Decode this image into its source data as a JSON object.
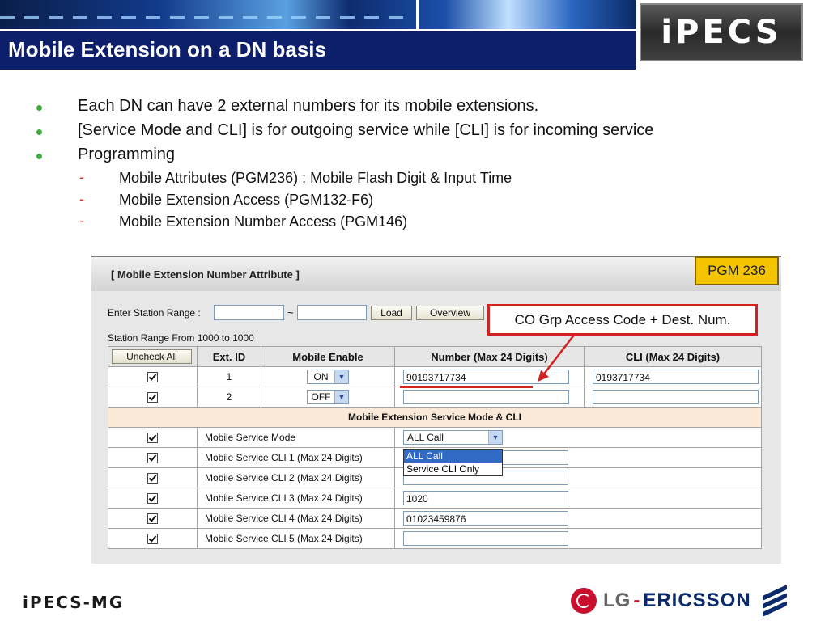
{
  "header": {
    "title": "Mobile Extension on a DN basis",
    "logo_text": "iPECS"
  },
  "bullets": [
    "Each DN can have 2 external numbers for its mobile extensions.",
    "[Service Mode and CLI] is for outgoing service while [CLI] is for incoming service",
    "Programming"
  ],
  "sub_bullets": [
    "Mobile Attributes (PGM236) : Mobile Flash Digit & Input Time",
    "Mobile Extension Access (PGM132-F6)",
    "Mobile Extension Number Access (PGM146)"
  ],
  "panel": {
    "title": "[ Mobile Extension Number Attribute ]",
    "pgm_badge": "PGM 236",
    "range_label": "Enter Station Range :",
    "range_from_value": "",
    "range_to_value": "",
    "load_label": "Load",
    "overview_label": "Overview",
    "range_info": "Station Range From 1000 to 1000",
    "callout": "CO Grp Access Code + Dest. Num.",
    "columns": {
      "uncheck_all": "Uncheck All",
      "ext_id": "Ext. ID",
      "mobile_enable": "Mobile Enable",
      "number": "Number (Max 24 Digits)",
      "cli": "CLI (Max 24 Digits)"
    },
    "ext_rows": [
      {
        "ext_id": "1",
        "enable": "ON",
        "number": "90193717734",
        "cli": "0193717734"
      },
      {
        "ext_id": "2",
        "enable": "OFF",
        "number": "",
        "cli": ""
      }
    ],
    "section_title": "Mobile Extension Service Mode & CLI",
    "service_rows": [
      {
        "label": "Mobile Service Mode",
        "value": "ALL Call"
      },
      {
        "label": "Mobile Service CLI 1 (Max 24 Digits)",
        "value": ""
      },
      {
        "label": "Mobile Service CLI 2 (Max 24 Digits)",
        "value": ""
      },
      {
        "label": "Mobile Service CLI 3 (Max 24 Digits)",
        "value": "1020"
      },
      {
        "label": "Mobile Service CLI 4 (Max 24 Digits)",
        "value": "01023459876"
      },
      {
        "label": "Mobile Service CLI 5 (Max 24 Digits)",
        "value": ""
      }
    ],
    "dropdown_options": [
      "ALL Call",
      "Service CLI Only"
    ]
  },
  "footer": {
    "left_logo": "iPECS-MG",
    "lg": "LG",
    "dash": "-",
    "ericsson": "ERICSSON"
  },
  "colors": {
    "title_bar": "#0d1f6b",
    "bullet_dot": "#3cae3c",
    "sub_dash": "#d9362c",
    "pgm_badge": "#f5c400",
    "callout_border": "#d32020",
    "section_row": "#fbe9d8"
  }
}
